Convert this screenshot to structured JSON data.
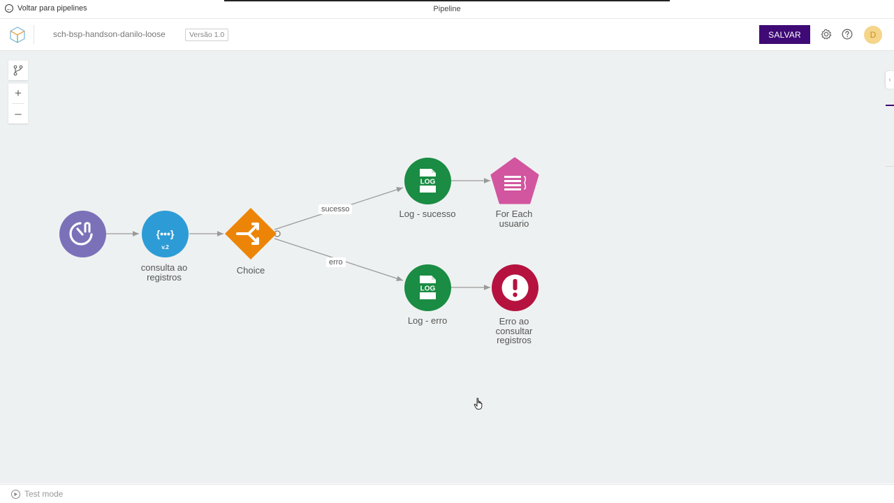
{
  "topbar": {
    "back_label": "Voltar para pipelines",
    "window_title": "Pipeline"
  },
  "header": {
    "pipeline_name": "sch-bsp-handson-danilo-loose",
    "version": "Versão 1.0",
    "save_label": "SALVAR",
    "avatar_initial": "D",
    "icons": [
      "settings-icon",
      "help-icon"
    ]
  },
  "canvas": {
    "nodes": [
      {
        "id": "trigger",
        "label": "",
        "icon": "scheduler-trigger-icon",
        "color": "#7b71b9"
      },
      {
        "id": "consulta",
        "label_line1": "consulta ao",
        "label_line2": "registros",
        "icon_text": "{•••}",
        "badge": "v.2",
        "color": "#2d9cd6"
      },
      {
        "id": "choice",
        "label": "Choice",
        "icon": "choice-split-icon",
        "color": "#ec8507"
      },
      {
        "id": "log_sucesso",
        "label": "Log - sucesso",
        "icon_text": "LOG",
        "color": "#1a8c43"
      },
      {
        "id": "foreach",
        "label_line1": "For Each",
        "label_line2": "usuario",
        "icon": "for-each-icon",
        "color": "#d2559f"
      },
      {
        "id": "log_erro",
        "label": "Log - erro",
        "icon_text": "LOG",
        "color": "#1a8c43"
      },
      {
        "id": "erro_consulta",
        "label_line1": "Erro ao",
        "label_line2": "consultar",
        "label_line3": "registros",
        "icon": "error-exclamation-icon",
        "color": "#b5123f"
      }
    ],
    "edges": {
      "sucesso_label": "sucesso",
      "erro_label": "erro"
    }
  },
  "footer": {
    "test_mode_label": "Test mode"
  }
}
